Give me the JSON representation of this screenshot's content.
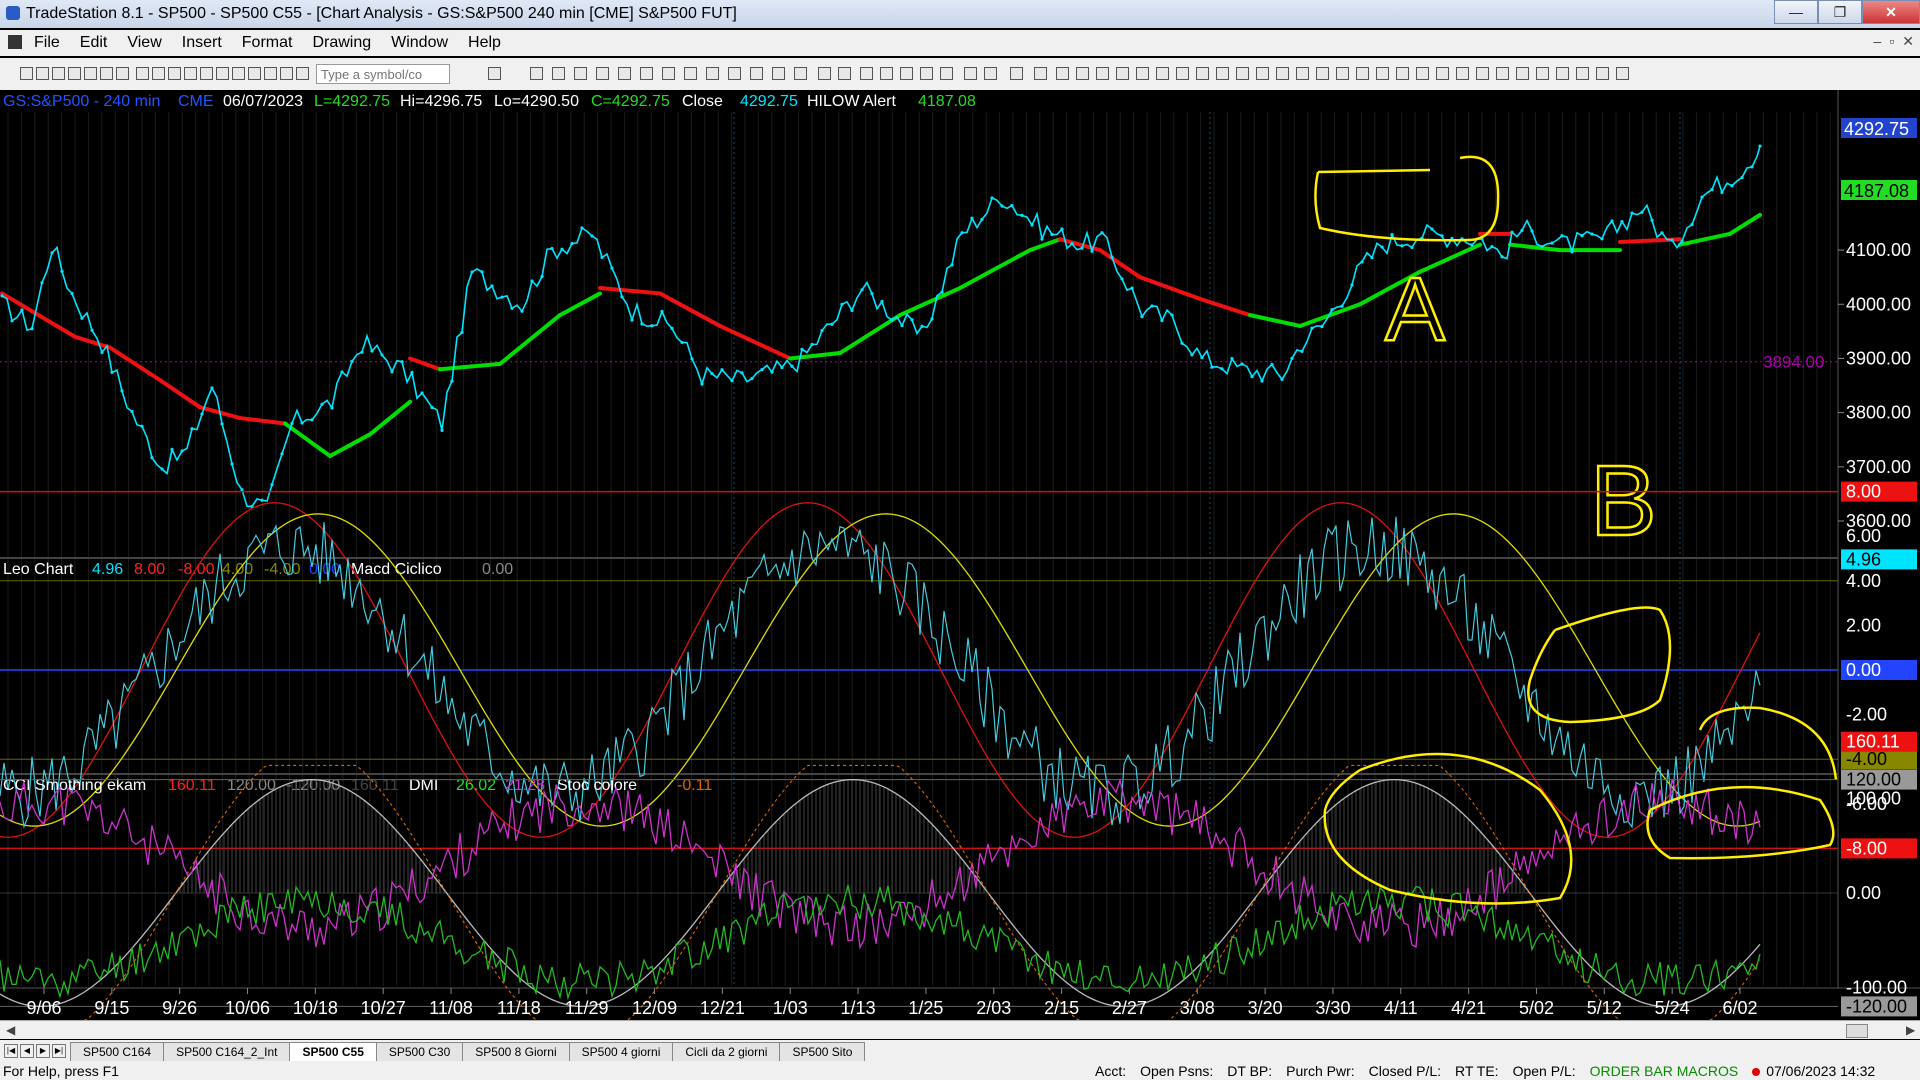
{
  "window": {
    "title": "TradeStation 8.1 - SP500 - SP500 C55 - [Chart Analysis - GS:S&P500  240 min  [CME] S&P500 FUT]",
    "minimize": "—",
    "restore": "❐",
    "close": "✕"
  },
  "menu": {
    "items": [
      "File",
      "Edit",
      "View",
      "Insert",
      "Format",
      "Drawing",
      "Window",
      "Help"
    ],
    "mdi_controls": [
      "–",
      "▫",
      "✕"
    ]
  },
  "toolbar": {
    "symbol_placeholder": "Type a symbol/co"
  },
  "price_panel": {
    "symbol": "GS:S&P500 - 240 min",
    "exchange": "CME",
    "date": "06/07/2023",
    "L": "L=4292.75",
    "Hi": "Hi=4296.75",
    "Lo": "Lo=4290.50",
    "C": "C=4292.75",
    "close_label": "Close",
    "close_value": "4292.75",
    "alert_label": "HILOW Alert",
    "alert_value": "4187.08",
    "level_label": "3894.00",
    "badge_last": "4292.75",
    "badge_alert": "4187.08",
    "axis_labels": [
      "4100.00",
      "4000.00",
      "3900.00",
      "3800.00",
      "3700.00",
      "3600.00"
    ],
    "axis_values": [
      4100,
      4000,
      3900,
      3800,
      3700,
      3600
    ],
    "annotation_a": "A",
    "annotation_b": "B"
  },
  "leo_panel": {
    "name": "Leo Chart",
    "values": [
      "4.96",
      "8.00",
      "-8.00",
      "4.00",
      "-4.00",
      "0.00"
    ],
    "macd_label": "Macd Ciclico",
    "macd_value": "0.00",
    "axis_labels": [
      "8.00",
      "6.00",
      "4.96",
      "4.00",
      "2.00",
      "0.00",
      "-2.00",
      "-4.00",
      "-6.00",
      "-8.00"
    ],
    "axis_values": [
      8,
      6,
      4.96,
      4,
      2,
      0,
      -2,
      -4,
      -6,
      -8
    ]
  },
  "cci_panel": {
    "name": "CCI Smothing ekam",
    "values": [
      "160.11",
      "120.00",
      "-120.00",
      "160.11"
    ],
    "dmi_label": "DMI",
    "dmi_values": [
      "26.02",
      "21.28"
    ],
    "stoc_label": "Stoc colore",
    "stoc_value": "-0.11",
    "axis_labels": [
      "160.11",
      "120.00",
      "100.00",
      "0.00",
      "-100.00",
      "-120.00"
    ],
    "axis_values": [
      160.11,
      120,
      100,
      0,
      -100,
      -120
    ]
  },
  "date_axis": [
    "9/06",
    "9/15",
    "9/26",
    "10/06",
    "10/18",
    "10/27",
    "11/08",
    "11/18",
    "11/29",
    "12/09",
    "12/21",
    "1/03",
    "1/13",
    "1/25",
    "2/03",
    "2/15",
    "2/27",
    "3/08",
    "3/20",
    "3/30",
    "4/11",
    "4/21",
    "5/02",
    "5/12",
    "5/24",
    "6/02"
  ],
  "colors": {
    "price": "#00e5ff",
    "ma_up": "#00dd00",
    "ma_down": "#ee1111",
    "yellow": "#ffee00",
    "magenta": "#cc33cc",
    "green_dmi": "#22bb22",
    "gray": "#aaaaaa"
  },
  "sheet_tabs": [
    "SP500 C164",
    "SP500 C164_2_Int",
    "SP500 C55",
    "SP500 C30",
    "SP500 8 Giorni",
    "SP500 4 giorni",
    "Cicli da 2 giorni",
    "SP500 Sito"
  ],
  "active_tab": "SP500 C55",
  "status": {
    "help": "For Help, press F1",
    "fields": [
      "Acct:",
      "Open Psns:",
      "DT BP:",
      "Purch Pwr:",
      "Closed P/L:",
      "RT TE:",
      "Open P/L:"
    ],
    "macros": "ORDER BAR  MACROS",
    "datetime": "07/06/2023 14:32"
  }
}
